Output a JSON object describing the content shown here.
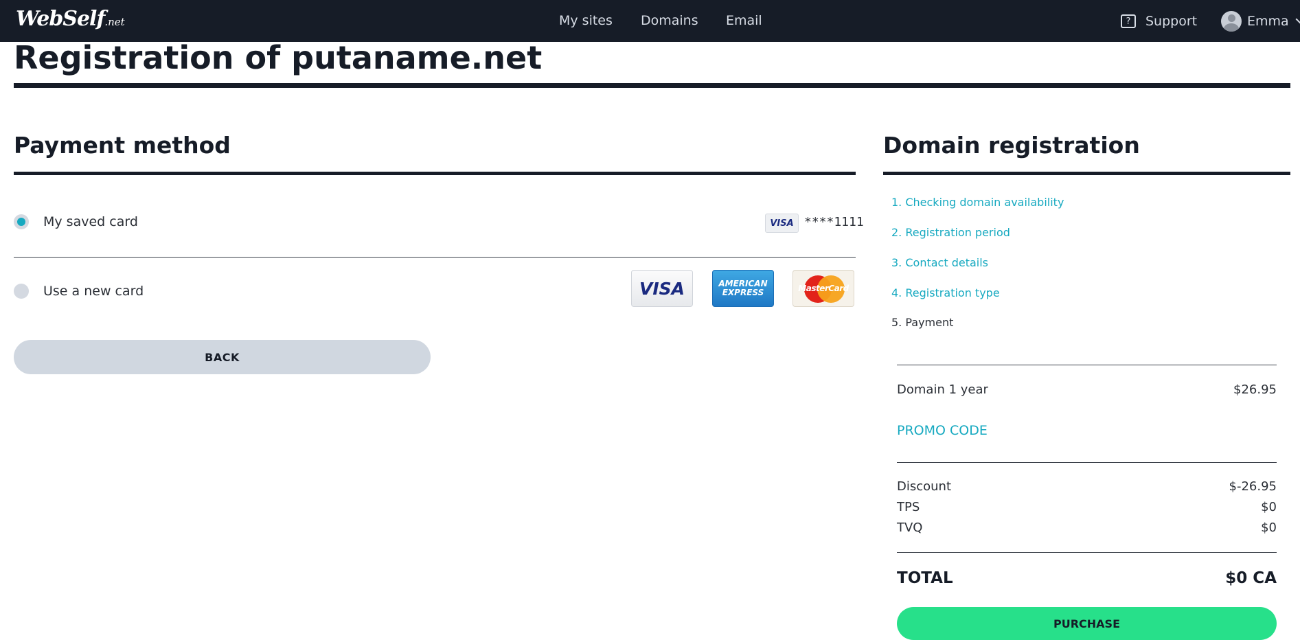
{
  "topbar": {
    "logo_main": "WebSelf",
    "logo_sub": ".net",
    "nav": [
      "My sites",
      "Domains",
      "Email"
    ],
    "support_label": "Support",
    "support_icon_glyph": "?",
    "user_name": "Emma"
  },
  "page": {
    "title": "Registration of putaname.net"
  },
  "payment": {
    "title": "Payment method",
    "saved_card_label": "My saved card",
    "saved_card_brand": "VISA",
    "saved_card_digits": "****1111",
    "new_card_label": "Use a new card",
    "card_logos": {
      "visa": "VISA",
      "amex_line1": "AMERICAN",
      "amex_line2": "EXPRESS",
      "mastercard": "MasterCard"
    },
    "selected_option": "My saved card",
    "back_label": "BACK"
  },
  "summary": {
    "title": "Domain registration",
    "steps": [
      "1. Checking domain availability",
      "2. Registration period",
      "3. Contact details",
      "4. Registration type",
      "5. Payment"
    ],
    "current_step": "5. Payment",
    "line_item_label": "Domain 1 year",
    "line_item_price": "$26.95",
    "promo_label": "PROMO CODE",
    "discount_label": "Discount",
    "discount_value": "$-26.95",
    "tps_label": "TPS",
    "tps_value": "$0",
    "tvq_label": "TVQ",
    "tvq_value": "$0",
    "total_label": "TOTAL",
    "total_value": "$0 CA",
    "purchase_label": "PURCHASE"
  },
  "colors": {
    "topbar_bg": "#161c27",
    "accent_teal": "#16a9c0",
    "purchase_green": "#27e08a",
    "back_button_bg": "#d0d7e0"
  }
}
